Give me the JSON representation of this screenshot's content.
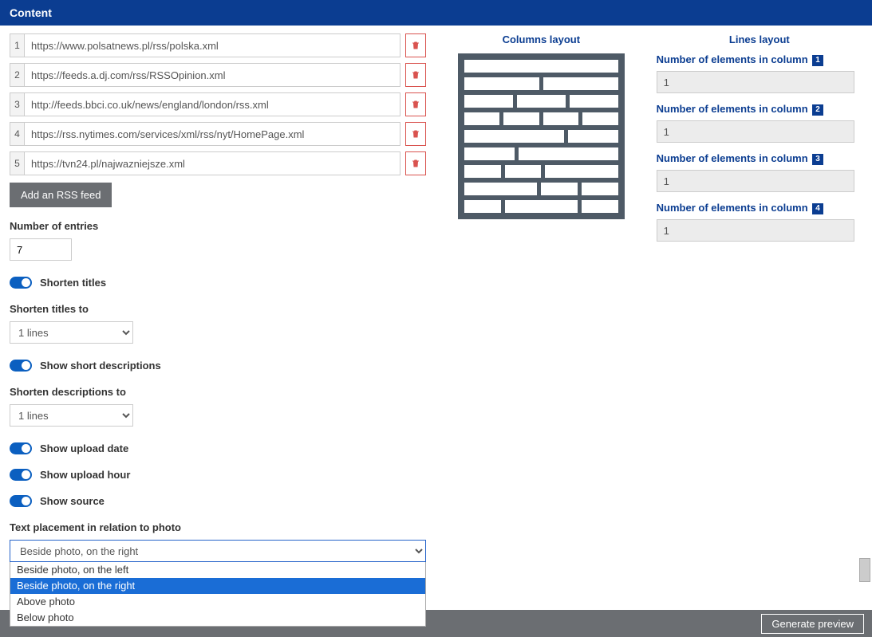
{
  "header": {
    "title": "Content"
  },
  "feeds": {
    "items": [
      {
        "num": "1",
        "url": "https://www.polsatnews.pl/rss/polska.xml"
      },
      {
        "num": "2",
        "url": "https://feeds.a.dj.com/rss/RSSOpinion.xml"
      },
      {
        "num": "3",
        "url": "http://feeds.bbci.co.uk/news/england/london/rss.xml"
      },
      {
        "num": "4",
        "url": "https://rss.nytimes.com/services/xml/rss/nyt/HomePage.xml"
      },
      {
        "num": "5",
        "url": "https://tvn24.pl/najwazniejsze.xml"
      }
    ],
    "add_button": "Add an RSS feed"
  },
  "entries": {
    "label": "Number of entries",
    "value": "7"
  },
  "toggles": {
    "shorten_titles": "Shorten titles",
    "show_desc": "Show short descriptions",
    "upload_date": "Show upload date",
    "upload_hour": "Show upload hour",
    "show_source": "Show source"
  },
  "shorten_titles_to": {
    "label": "Shorten titles to",
    "value": "1 lines"
  },
  "shorten_desc_to": {
    "label": "Shorten descriptions to",
    "value": "1 lines"
  },
  "placement": {
    "label": "Text placement in relation to photo",
    "value": "Beside photo, on the right",
    "options": [
      "Beside photo, on the left",
      "Beside photo, on the right",
      "Above photo",
      "Below photo"
    ],
    "selected_index": 1
  },
  "columns_layout": {
    "title": "Columns layout"
  },
  "lines_layout": {
    "title": "Lines layout",
    "groups": [
      {
        "label_prefix": "Number of elements in column",
        "badge": "1",
        "value": "1"
      },
      {
        "label_prefix": "Number of elements in column",
        "badge": "2",
        "value": "1"
      },
      {
        "label_prefix": "Number of elements in column",
        "badge": "3",
        "value": "1"
      },
      {
        "label_prefix": "Number of elements in column",
        "badge": "4",
        "value": "1"
      }
    ]
  },
  "footer": {
    "generate": "Generate preview"
  }
}
